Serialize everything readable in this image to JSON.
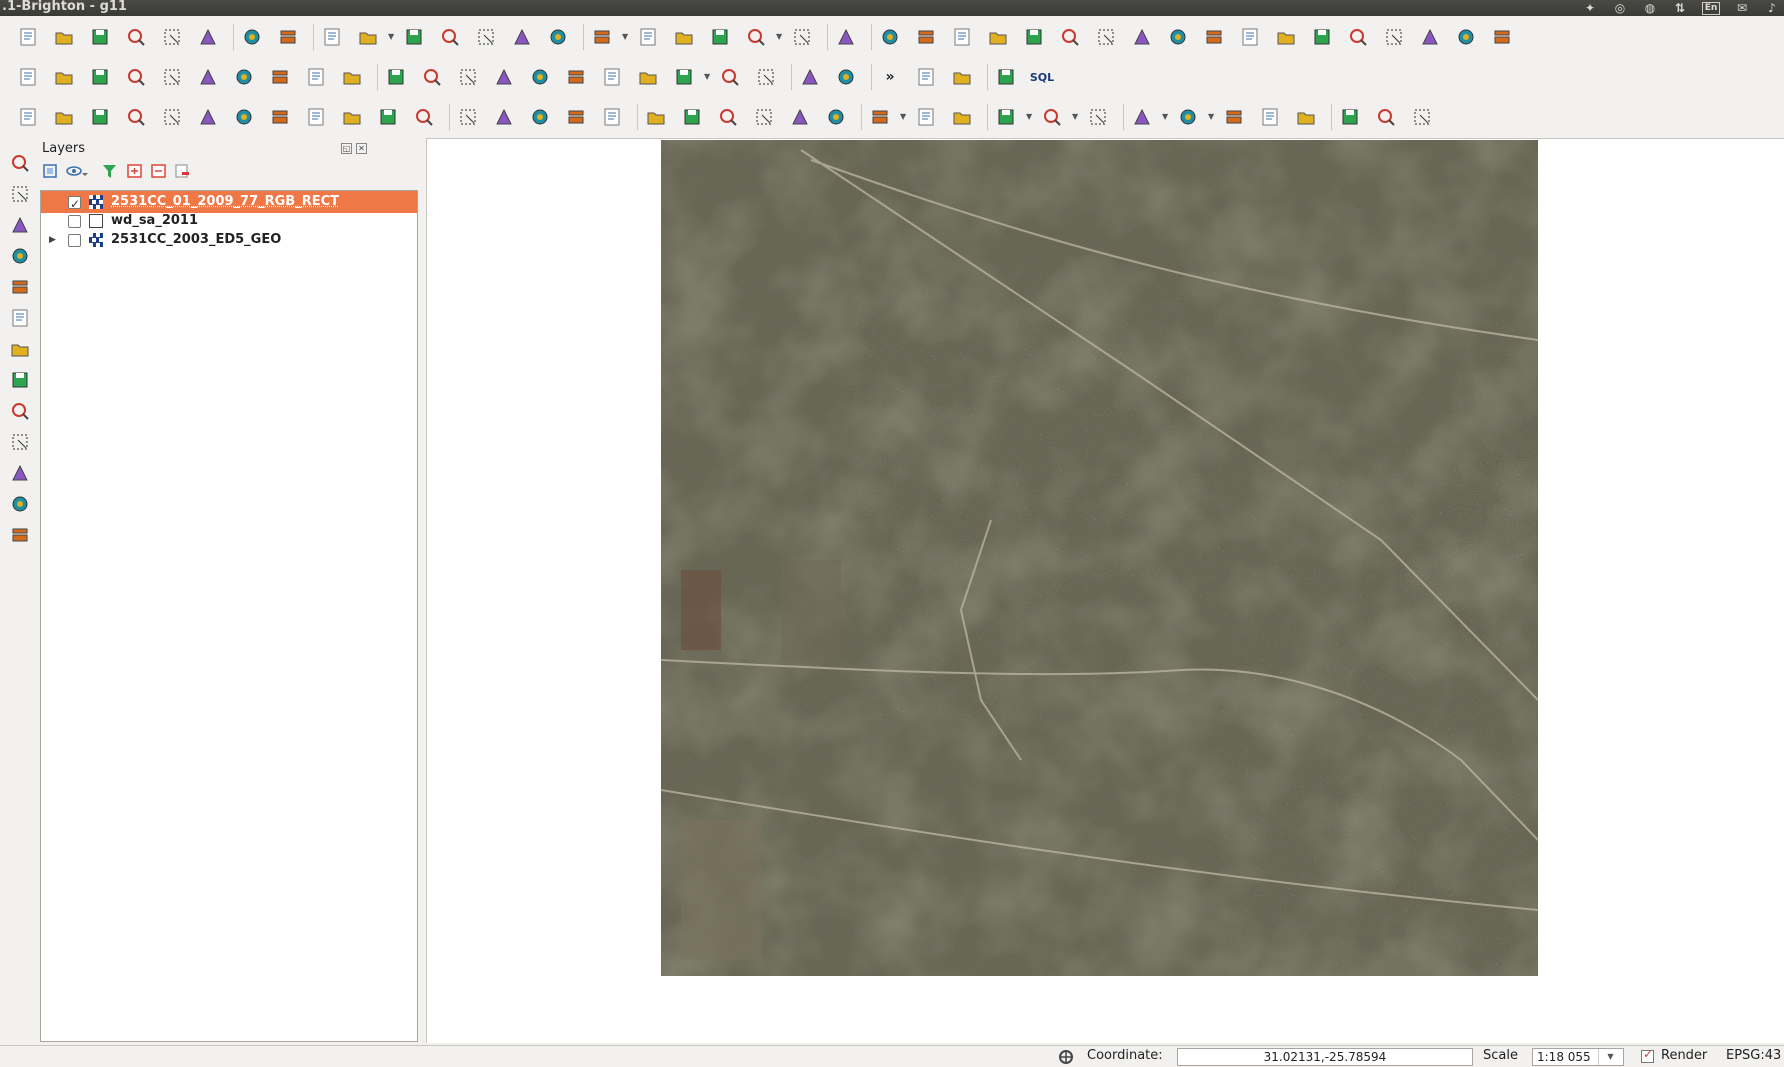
{
  "window": {
    "title": ".1-Brighton - g11"
  },
  "tray": {
    "lang": "En"
  },
  "toolbar1": {
    "buttons": [
      "new-project",
      "open-project",
      "save-project",
      "save-as",
      "new-print-composer",
      "composer-manager",
      "help-contents",
      "whats-this",
      "identify",
      "zoom-to-selection",
      "select-features",
      "deselect",
      "expression-select",
      "open-attribute-table",
      "field-calculator",
      "measure-line",
      "annotation",
      "add-feature-text",
      "add-feature-picture",
      "text-annotation",
      "georeferencer",
      "grass-tools",
      "processing-toolbox",
      "map-grid",
      "python-console",
      "show-hide",
      "add-vector-layer",
      "color-table",
      "metadata",
      "capture",
      "plugin",
      "topology",
      "heatmap",
      "interpolation",
      "raster-calc",
      "statistics",
      "spatial-query",
      "convert",
      "add-plugin",
      "digitize"
    ]
  },
  "toolbar2": {
    "buttons": [
      "toggle-editing",
      "current-edits",
      "save-edits",
      "add-feature",
      "move-feature",
      "node-tool",
      "delete-selected",
      "cut-features",
      "copy-features",
      "paste-features",
      "xy-tools",
      "add-wkt",
      "add-vector",
      "add-raster",
      "add-postgis",
      "add-spatialite",
      "add-wms",
      "add-wcs",
      "add-wfs",
      "add-oracle",
      "add-delimited-text",
      "label-tool",
      "label-settings",
      "more",
      "python",
      "grass-region",
      "db-manager",
      "sql-tool"
    ],
    "more_label": "»",
    "sql_label": "SQL"
  },
  "toolbar3": {
    "buttons": [
      "histogram",
      "stretch",
      "local-stretch",
      "cumulative-cut",
      "increase-brightness",
      "decrease-brightness",
      "increase-contrast",
      "decrease-contrast",
      "grid-tool",
      "raster-statistics",
      "raster-info",
      "align-tools",
      "rotate-label",
      "pin-label",
      "hide-label",
      "move-label",
      "rotate-feature",
      "simplify-feature",
      "change-label",
      "cad-tool",
      "measure-angle",
      "snapping",
      "gps-location",
      "layer-symbol",
      "reshape",
      "offset-curve",
      "split-features",
      "merge-features",
      "reshape-features",
      "fill-ring",
      "delete-ring",
      "add-part",
      "delete-part",
      "rotate-point",
      "v-tool",
      "merge-attributes",
      "select-area"
    ]
  },
  "left_toolbar": {
    "buttons": [
      "map-view",
      "map-tips",
      "pan-tool",
      "pan-to-selection",
      "zoom-in",
      "zoom-out",
      "zoom-actual",
      "zoom-full",
      "zoom-layer",
      "zoom-last",
      "zoom-next",
      "zoom-native",
      "refresh"
    ]
  },
  "layers_panel": {
    "title": "Layers",
    "layers": [
      {
        "name": "2531CC_01_2009_77_RGB_RECT",
        "checked": true,
        "selected": true,
        "type": "raster",
        "expandable": false
      },
      {
        "name": "wd_sa_2011",
        "checked": false,
        "selected": false,
        "type": "vector-polygon",
        "expandable": false
      },
      {
        "name": "2531CC_2003_ED5_GEO",
        "checked": false,
        "selected": false,
        "type": "raster",
        "expandable": true
      }
    ]
  },
  "status": {
    "coordinate_label": "Coordinate:",
    "coordinate_value": "31.02131,-25.78594",
    "scale_label": "Scale",
    "scale_value": "1:18 055",
    "render_label": "Render",
    "render_checked": true,
    "crs": "EPSG:43"
  }
}
